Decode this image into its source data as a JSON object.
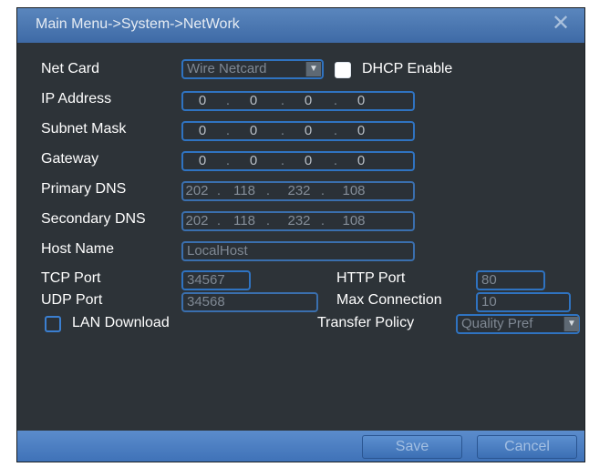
{
  "window": {
    "title": "Main Menu->System->NetWork",
    "close_symbol": "✕"
  },
  "colors": {
    "title_bar": "#4a78b3",
    "panel": "#2d3338",
    "field_border": "#2f73c1",
    "label_text": "#ffffff"
  },
  "form": {
    "net_card": {
      "label": "Net Card",
      "value": "Wire Netcard",
      "arrow": "▼"
    },
    "dhcp": {
      "label": "DHCP Enable",
      "checked": true
    },
    "ip_address": {
      "label": "IP Address",
      "octets": [
        "0",
        "0",
        "0",
        "0"
      ]
    },
    "subnet_mask": {
      "label": "Subnet Mask",
      "octets": [
        "0",
        "0",
        "0",
        "0"
      ]
    },
    "gateway": {
      "label": "Gateway",
      "octets": [
        "0",
        "0",
        "0",
        "0"
      ]
    },
    "primary_dns": {
      "label": "Primary DNS",
      "octets": [
        "202",
        "118",
        "232",
        "108"
      ]
    },
    "secondary_dns": {
      "label": "Secondary DNS",
      "octets": [
        "202",
        "118",
        "232",
        "108"
      ]
    },
    "host_name": {
      "label": "Host Name",
      "value": "LocalHost"
    },
    "tcp_port": {
      "label": "TCP Port",
      "value": "34567"
    },
    "http_port": {
      "label": "HTTP Port",
      "value": "80"
    },
    "udp_port": {
      "label": "UDP Port",
      "value": "34568"
    },
    "max_connection": {
      "label": "Max Connection",
      "value": "10"
    },
    "lan_download": {
      "label": "LAN Download",
      "checked": false
    },
    "transfer_policy": {
      "label": "Transfer Policy",
      "value": "Quality Pref",
      "arrow": "▼"
    }
  },
  "buttons": {
    "save": "Save",
    "cancel": "Cancel"
  }
}
